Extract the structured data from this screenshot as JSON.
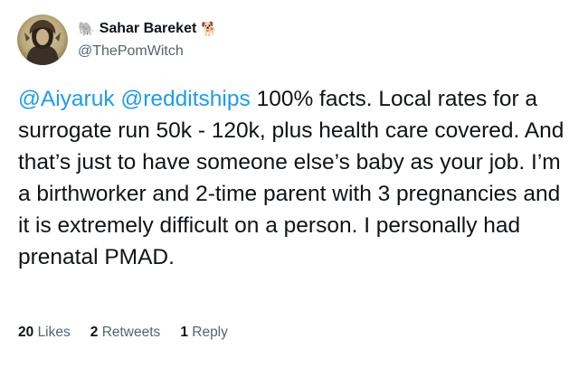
{
  "author": {
    "display_name": "Sahar Bareket",
    "handle": "@ThePomWitch",
    "emoji_left": "🐘",
    "emoji_right": "🐕"
  },
  "tweet": {
    "mentions": [
      "@Aiyaruk",
      "@redditships"
    ],
    "text": "100% facts. Local rates for a surrogate run 50k - 120k, plus health care covered. And that’s just to have someone else’s baby as your job. I’m a birthworker and 2-time parent with 3 pregnancies and it is extremely difficult on a person. I personally had prenatal PMAD."
  },
  "stats": {
    "likes_count": "20",
    "likes_label": "Likes",
    "retweets_count": "2",
    "retweets_label": "Retweets",
    "replies_count": "1",
    "replies_label": "Reply"
  }
}
